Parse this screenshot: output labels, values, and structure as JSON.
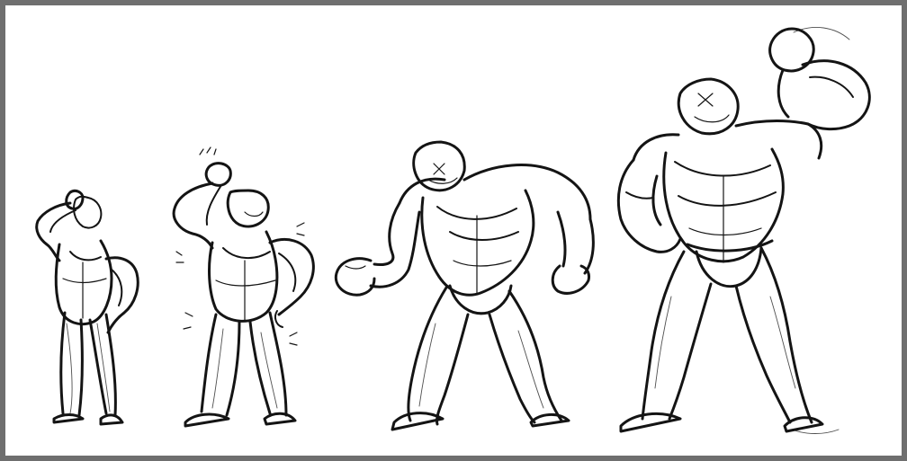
{
  "image": {
    "kind": "sketch-lineart",
    "palette": {
      "border": "#6f6f6f",
      "paper": "#ffffff",
      "ink": "#141414"
    },
    "figures": [
      {
        "id": "stage-1",
        "pose": "flexing-one-arm",
        "scale": "small"
      },
      {
        "id": "stage-2",
        "pose": "flexing-with-trembling-marks",
        "scale": "medium"
      },
      {
        "id": "stage-3",
        "pose": "wide-stance-arms-out",
        "scale": "large"
      },
      {
        "id": "stage-4",
        "pose": "double-flex-one-arm-up",
        "scale": "largest"
      }
    ]
  }
}
